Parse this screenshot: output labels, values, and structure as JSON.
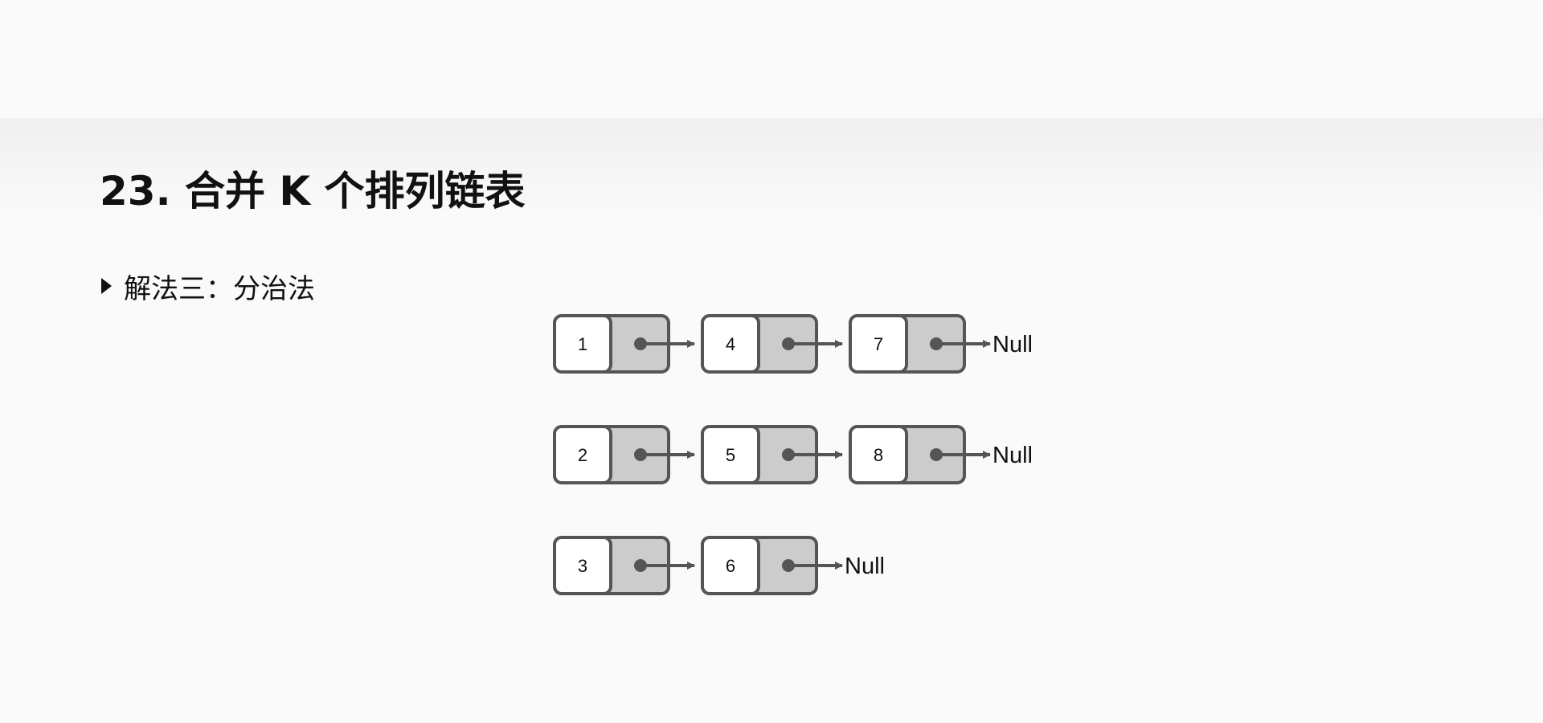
{
  "page": {
    "title": "23. 合并 K 个排列链表",
    "section_label": "解法三：分治法"
  },
  "colors": {
    "node_border": "#555555",
    "pointer_fill": "#cccccc",
    "value_fill": "#ffffff",
    "arrow": "#555555"
  },
  "diagram": {
    "lists": [
      {
        "nodes": [
          "1",
          "4",
          "7"
        ],
        "terminal": "Null"
      },
      {
        "nodes": [
          "2",
          "5",
          "8"
        ],
        "terminal": "Null"
      },
      {
        "nodes": [
          "3",
          "6"
        ],
        "terminal": "Null"
      }
    ]
  }
}
